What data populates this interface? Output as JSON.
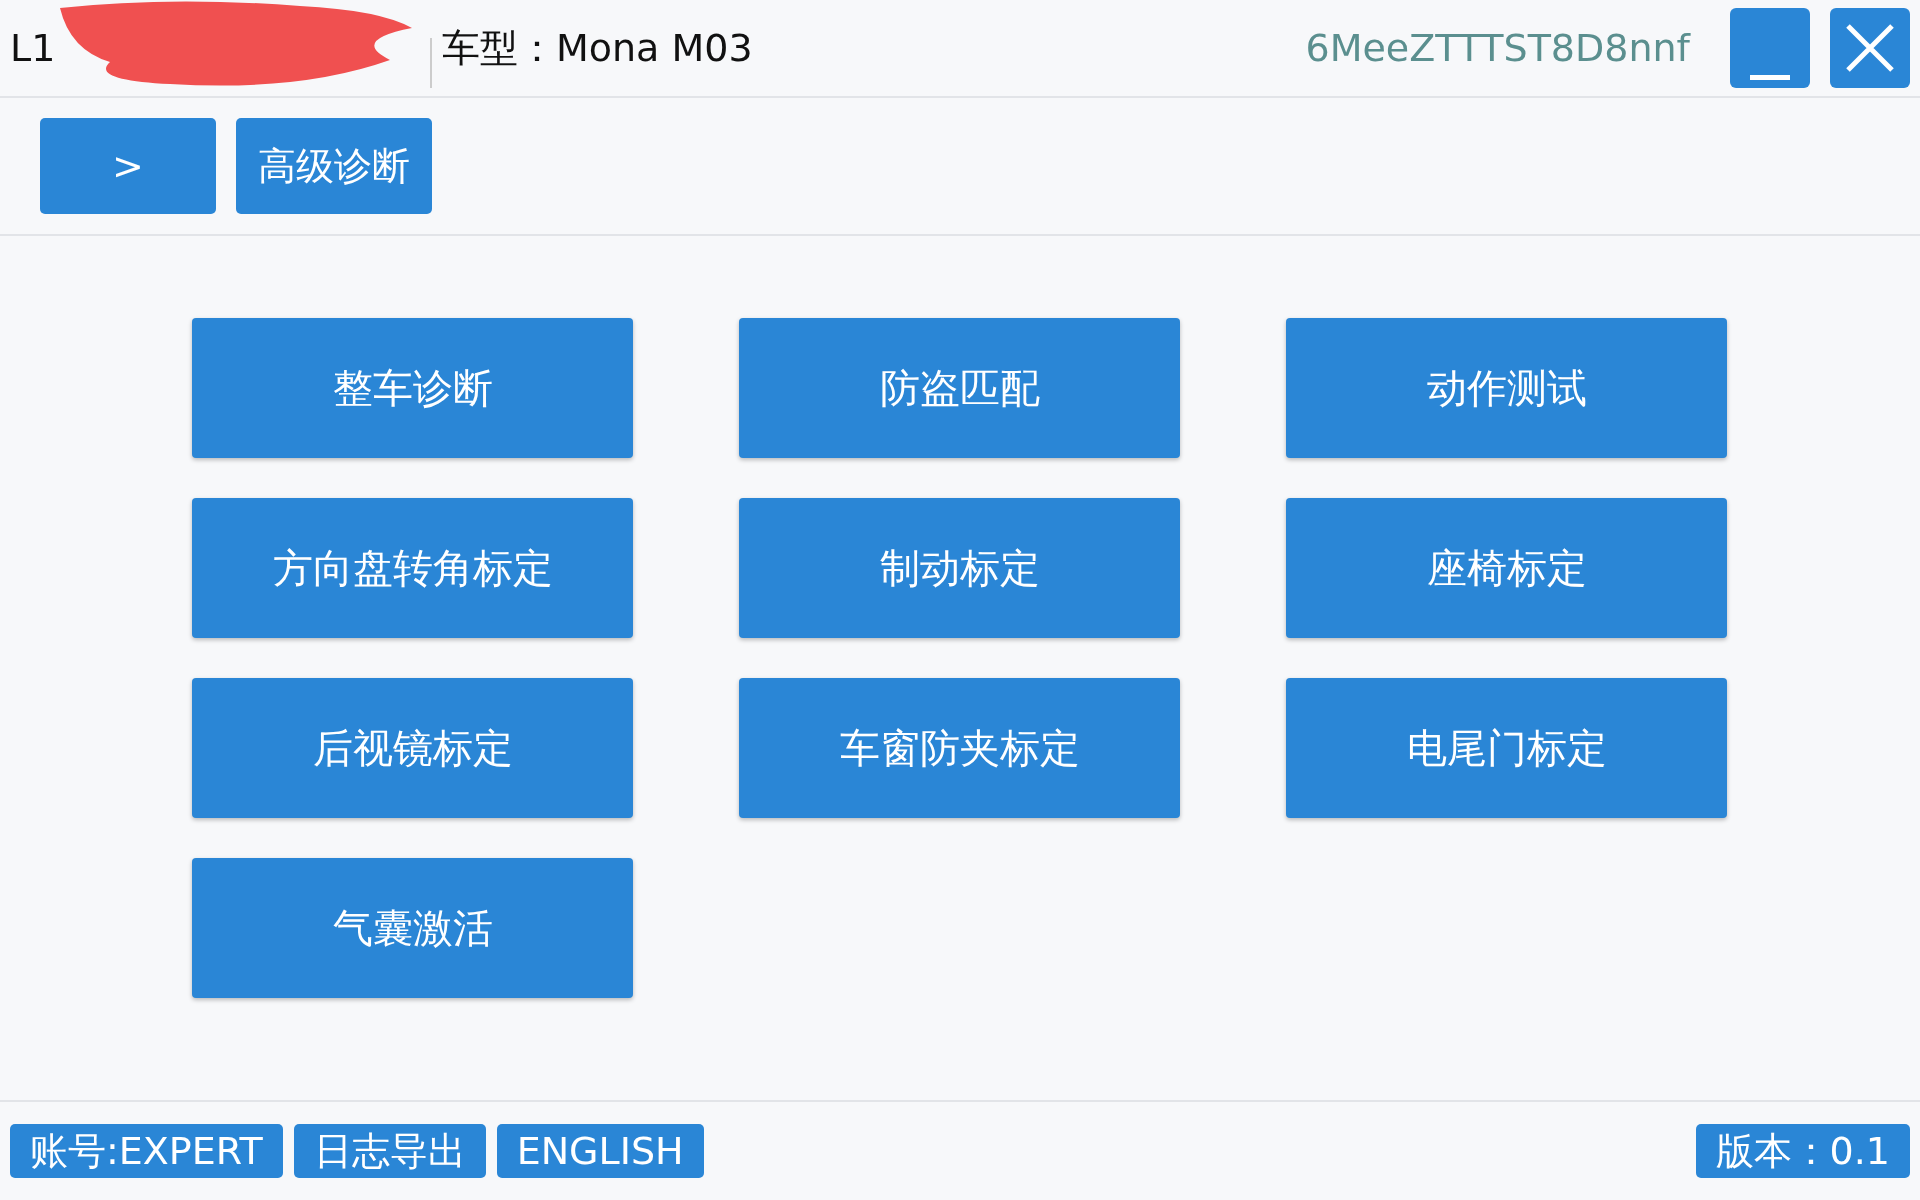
{
  "header": {
    "vehicle_id": "L1",
    "redacted": true,
    "model": "车型：Mona M03",
    "device_id": "6MeeZTTTST8D8nnf",
    "window_buttons": [
      {
        "kind": "minimize"
      },
      {
        "kind": "close"
      }
    ]
  },
  "nav": [
    {
      "label": ">"
    },
    {
      "label": "高级诊断"
    }
  ],
  "functions": [
    {
      "label": "整车诊断"
    },
    {
      "label": "防盗匹配"
    },
    {
      "label": "动作测试"
    },
    {
      "label": "方向盘转角标定"
    },
    {
      "label": "制动标定"
    },
    {
      "label": "座椅标定"
    },
    {
      "label": "后视镜标定"
    },
    {
      "label": "车窗防夹标定"
    },
    {
      "label": "电尾门标定"
    },
    {
      "label": "气囊激活"
    }
  ],
  "footer": {
    "buttons": [
      {
        "label": "账号:EXPERT"
      },
      {
        "label": "日志导出"
      },
      {
        "label": "ENGLISH"
      }
    ],
    "version": "版本：0.1"
  }
}
